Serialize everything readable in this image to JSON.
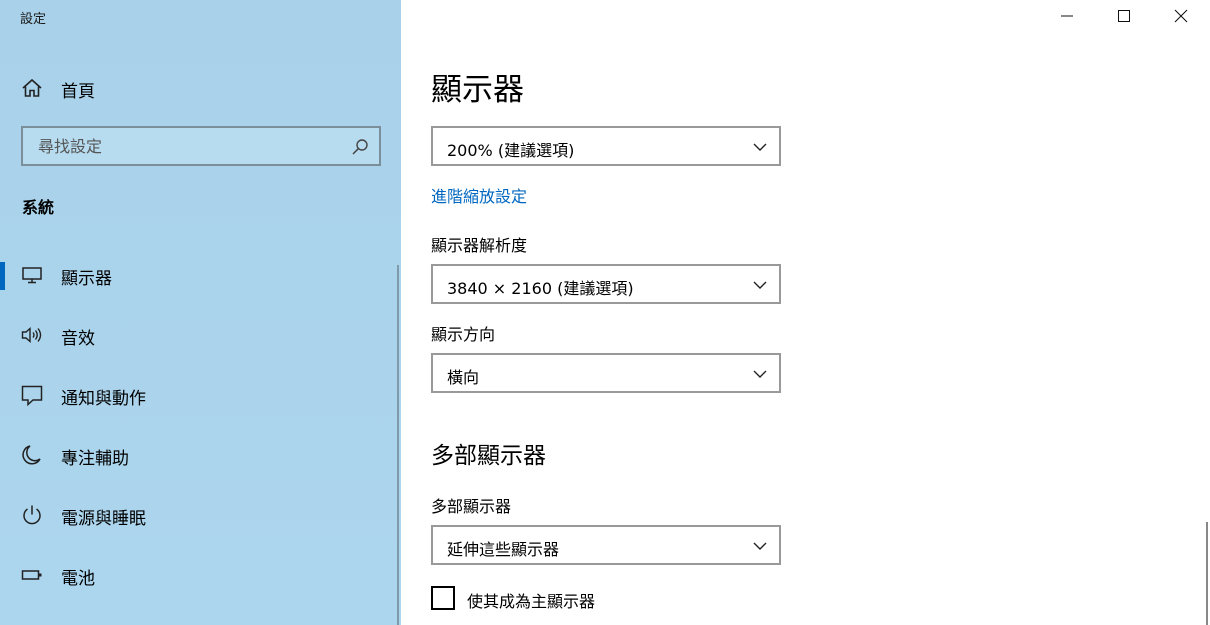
{
  "window": {
    "title": "設定",
    "controls": {
      "minimize_icon": "minimize-icon",
      "maximize_icon": "maximize-icon",
      "close_icon": "close-icon"
    }
  },
  "sidebar": {
    "home": {
      "label": "首頁",
      "icon": "home-icon"
    },
    "search": {
      "placeholder": "尋找設定",
      "icon": "search-icon"
    },
    "section": "系統",
    "items": [
      {
        "label": "顯示器",
        "icon": "monitor-icon",
        "active": true
      },
      {
        "label": "音效",
        "icon": "speaker-icon",
        "active": false
      },
      {
        "label": "通知與動作",
        "icon": "notification-icon",
        "active": false
      },
      {
        "label": "專注輔助",
        "icon": "moon-icon",
        "active": false
      },
      {
        "label": "電源與睡眠",
        "icon": "power-icon",
        "active": false
      },
      {
        "label": "電池",
        "icon": "battery-icon",
        "active": false
      }
    ]
  },
  "main": {
    "title": "顯示器",
    "scale": {
      "value": "200% (建議選項)"
    },
    "advanced_scaling_link": "進階縮放設定",
    "resolution": {
      "label": "顯示器解析度",
      "value": "3840 × 2160 (建議選項)"
    },
    "orientation": {
      "label": "顯示方向",
      "value": "橫向"
    },
    "multi": {
      "section_title": "多部顯示器",
      "label": "多部顯示器",
      "value": "延伸這些顯示器"
    },
    "make_main": {
      "label": "使其成為主顯示器",
      "checked": false
    }
  },
  "colors": {
    "sidebar_bg": "#a9d2ea",
    "accent": "#0067c0",
    "link": "#0067c0"
  }
}
